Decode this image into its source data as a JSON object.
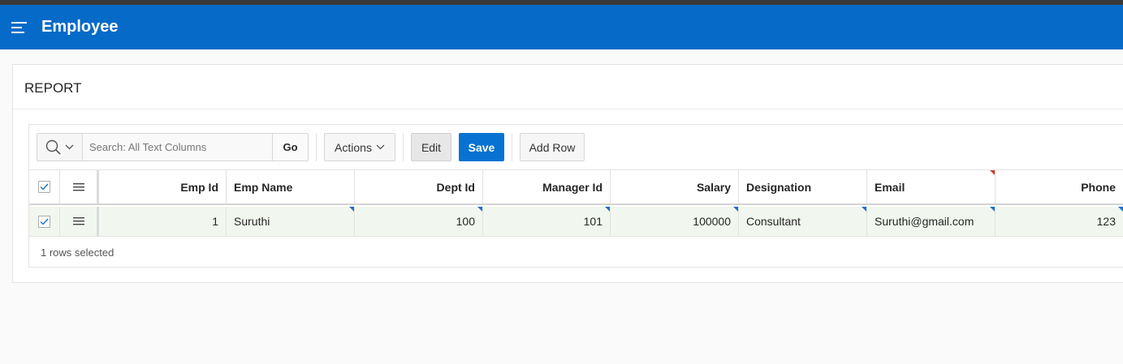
{
  "header": {
    "title": "Employee"
  },
  "region": {
    "title": "REPORT"
  },
  "toolbar": {
    "search_placeholder": "Search: All Text Columns",
    "go_label": "Go",
    "actions_label": "Actions",
    "edit_label": "Edit",
    "save_label": "Save",
    "add_row_label": "Add Row"
  },
  "grid": {
    "columns": [
      "Emp Id",
      "Emp Name",
      "Dept Id",
      "Manager Id",
      "Salary",
      "Designation",
      "Email",
      "Phone"
    ],
    "rows": [
      [
        "1",
        "Suruthi",
        "100",
        "101",
        "100000",
        "Consultant",
        "Suruthi@gmail.com",
        "123"
      ]
    ],
    "footer_text": "1 rows selected"
  },
  "colors": {
    "header_bg": "#056ac8",
    "save_bg": "#0772d1",
    "selected_row_bg": "#f1f7ee",
    "changed_marker": "#1f6fd0",
    "error_marker": "#d23d2b"
  }
}
